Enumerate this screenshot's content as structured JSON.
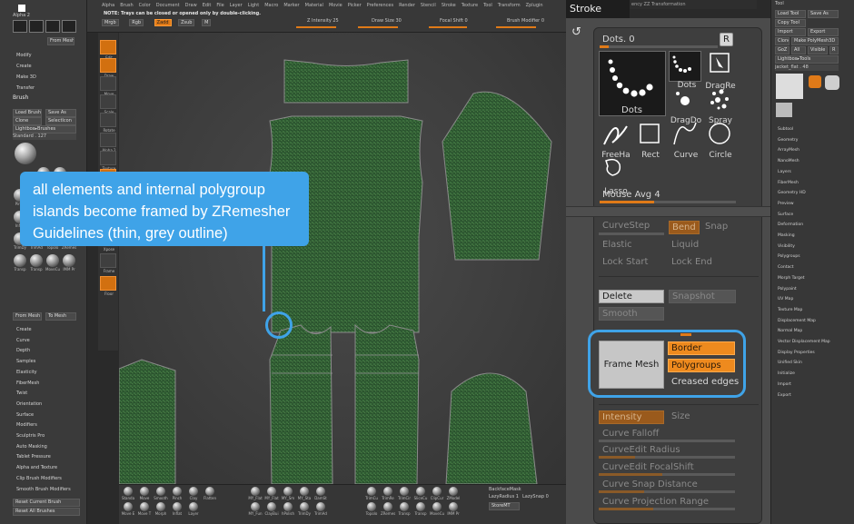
{
  "left_panel": {
    "alpha_label": "Alpha 2",
    "from_mesh": "From Mesh",
    "modify": "Modify",
    "create": "Create",
    "make3d": "Make 3D",
    "transfer": "Transfer",
    "brush_header": "Brush",
    "load_brush": "Load Brush",
    "save_as": "Save As",
    "clone": "Clone",
    "selecticon": "SelectIcon",
    "lightbox": "Lightbox▸Brushes",
    "standard": "Standard . 127",
    "brushes": [
      [
        "Clay",
        "ClayBui"
      ],
      [
        "Pinch",
        "Move E",
        "Move T",
        "Morph"
      ],
      [
        "Inflat",
        "Layer",
        "MY_Flat",
        "MY_Polish"
      ],
      [
        "TrimDy",
        "TrimAd",
        "Topolo",
        "ZRemes"
      ],
      [
        "Transp",
        "Transp",
        "MoveCu",
        "IMM Pr"
      ]
    ],
    "from_mesh2": "From Mesh",
    "to_mesh": "To Mesh",
    "menu": [
      "Create",
      "Curve",
      "Depth",
      "Samples",
      "Elasticity",
      "FiberMesh",
      "Twist",
      "Orientation",
      "Surface",
      "Modifiers",
      "Sculptris Pro",
      "Auto Masking",
      "Tablet Pressure",
      "Alpha and Texture",
      "Clip Brush Modifiers",
      "Smooth Brush Modifiers"
    ],
    "reset_current": "Reset Current Brush",
    "reset_all": "Reset All Brushes"
  },
  "topbar": {
    "menu": [
      "Alpha",
      "Brush",
      "Color",
      "Document",
      "Draw",
      "Edit",
      "File",
      "Layer",
      "Light",
      "Macro",
      "Marker",
      "Material",
      "Movie",
      "Picker",
      "Preferences",
      "Render",
      "Stencil",
      "Stroke",
      "Texture",
      "Tool",
      "Transform",
      "Zplugin"
    ],
    "note": "NOTE: Trays can be closed or opened only by double-clicking.",
    "controls": [
      "Mrgb",
      "Rgb",
      "Zadd",
      "Zsub",
      "M"
    ],
    "z_intensity": "Z Intensity 25",
    "draw_size": "Draw Size 30",
    "focal_shift": "Focal Shift 0",
    "brush_modifier": "Brush Modifier 0"
  },
  "vtools": [
    "Edit",
    "Draw",
    "Move",
    "Scale",
    "Rotate",
    "Alpha 2",
    "Texture",
    "Material",
    "Stroke",
    "Spray",
    "Xpose",
    "Frame",
    "Floor"
  ],
  "bottom_shelf": {
    "group1": [
      "Standa",
      "Move",
      "Smooth",
      "Pinch",
      "Clay",
      "Flatten"
    ],
    "group1b": [
      "Move E",
      "Move T",
      "Morph",
      "Inflat",
      "Layer"
    ],
    "group2": [
      "MY_Flat",
      "MY_Flat",
      "MY_Sm",
      "MY_Sta",
      "DamSt"
    ],
    "group2b": [
      "MY_Fun",
      "ClayBui",
      "hPolish",
      "TrimDy",
      "TrimAd"
    ],
    "group3": [
      "TrimCu",
      "TrimRe",
      "TrimCir",
      "SliceCu",
      "ClipCur",
      "ZModel"
    ],
    "group3b": [
      "Topolo",
      "ZRemes",
      "Transp",
      "Transp",
      "MoveCu",
      "IMM Pr"
    ],
    "backface": "BackfaceMask",
    "lazy_radius": "LazyRadius 1",
    "lazy_snap": "LazySnap 0",
    "store_mt": "StoreMT"
  },
  "stroke": {
    "tab": "Stroke",
    "strip": "ency      ZZ Transformation",
    "dots_slider": "Dots. 0",
    "r_button": "R",
    "big_icon_label": "Dots",
    "icons": [
      "Dots",
      "DragRe",
      "DragDo",
      "Spray",
      "FreeHa",
      "Rect",
      "Curve",
      "Circle",
      "Lasso"
    ],
    "mouse_avg": "Mouse Avg 4",
    "curve_step": "CurveStep",
    "bend": "Bend",
    "snap": "Snap",
    "elastic": "Elastic",
    "liquid": "Liquid",
    "lock_start": "Lock Start",
    "lock_end": "Lock End",
    "delete": "Delete",
    "snapshot": "Snapshot",
    "smooth": "Smooth",
    "frame_mesh": "Frame Mesh",
    "border": "Border",
    "polygroups": "Polygroups",
    "creased_edges": "Creased edges",
    "intensity": "Intensity",
    "size": "Size",
    "curve_falloff": "Curve Falloff",
    "curve_edit_radius": "CurveEdit Radius",
    "curve_edit_focal": "CurveEdit FocalShift",
    "curve_snap_distance": "Curve Snap Distance",
    "curve_projection_range": "Curve Projection Range",
    "highlight_color": "#3fa3e8",
    "accent_color": "#ee8a1e"
  },
  "right_panel": {
    "header": "Tool",
    "load_tool": "Load Tool",
    "save_as": "Save As",
    "copy_tool": "Copy Tool",
    "import": "Import",
    "export": "Export",
    "clone": "Clone",
    "make_polymesh": "Make PolyMesh3D",
    "goz": "GoZ",
    "all": "All",
    "visible": "Visible",
    "r": "R",
    "lightbox_tools": "Lightbox▸Tools",
    "jacket": "jacket_flat . 48",
    "items": [
      "Subtool",
      "Geometry",
      "ArrayMesh",
      "NanoMesh",
      "Layers",
      "FiberMesh",
      "Geometry HD",
      "Preview",
      "Surface",
      "Deformation",
      "Masking",
      "Visibility",
      "Polygroups",
      "Contact",
      "Morph Target",
      "Polypaint",
      "UV Map",
      "Texture Map",
      "Displacement Map",
      "Normal Map",
      "Vector Displacement Map",
      "Display Properties",
      "Unified Skin",
      "Initialize",
      "Import",
      "Export"
    ]
  },
  "callout": {
    "text": "all elements and internal polygroup islands become framed by ZRemesher Guidelines (thin, grey outline)"
  }
}
